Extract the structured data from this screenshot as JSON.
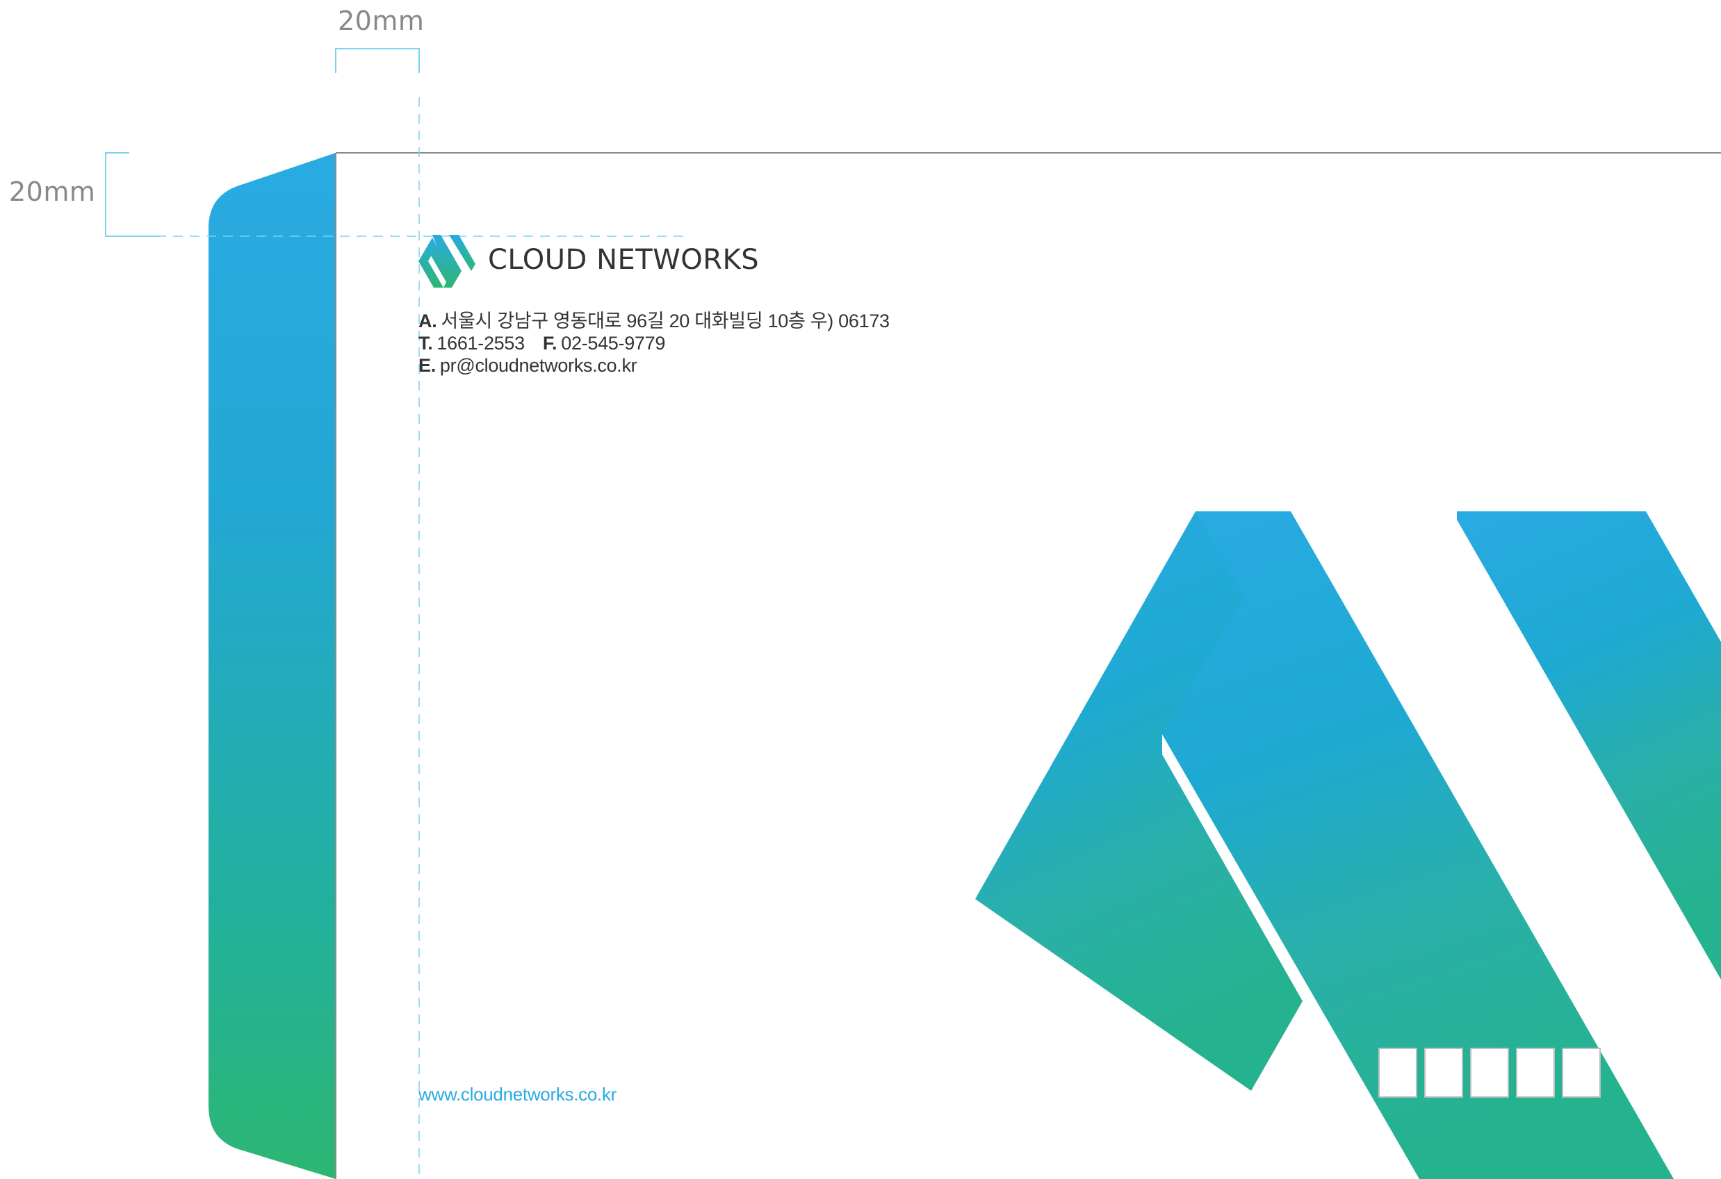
{
  "dimensions": {
    "top_label": "20mm",
    "left_label": "20mm"
  },
  "brand": {
    "name": "CLOUD NETWORKS",
    "logo_icon": "cloud-networks-logo-icon",
    "gradient_top": "#29abe2",
    "gradient_bottom": "#2db672"
  },
  "contact": {
    "address_key": "A.",
    "address": "서울시 강남구 영동대로 96길 20 대화빌딩 10층 우) 06173",
    "phone_key": "T.",
    "phone": "1661-2553",
    "fax_key": "F.",
    "fax": "02-545-9779",
    "email_key": "E.",
    "email": "pr@cloudnetworks.co.kr"
  },
  "website": "www.cloudnetworks.co.kr",
  "postal_code_boxes": [
    "",
    "",
    "",
    "",
    ""
  ],
  "colors": {
    "guide_line": "#7dd3f0",
    "text_dark": "#333333",
    "text_gray": "#888888",
    "link_blue": "#29abe2"
  }
}
